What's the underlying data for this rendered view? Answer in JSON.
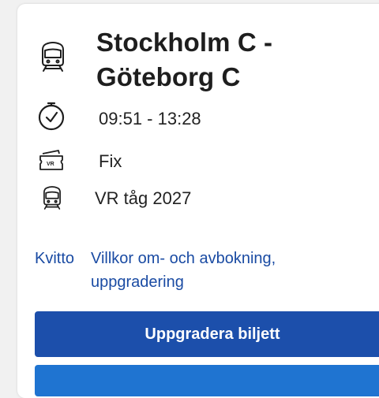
{
  "trip": {
    "route": "Stockholm C - Göteborg C",
    "time": "09:51 - 13:28",
    "ticket_type": "Fix",
    "train": "VR tåg 2027"
  },
  "icons": {
    "route": "train-icon",
    "time": "clock-icon",
    "ticket": "ticket-icon",
    "train": "train-icon"
  },
  "links": {
    "receipt": "Kvitto",
    "terms": "Villkor om- och avbokning, uppgradering"
  },
  "buttons": {
    "upgrade": "Uppgradera biljett",
    "secondary": ""
  },
  "colors": {
    "link": "#1a4ba3",
    "primary_button": "#1c4fab",
    "secondary_button": "#1f74d1"
  }
}
